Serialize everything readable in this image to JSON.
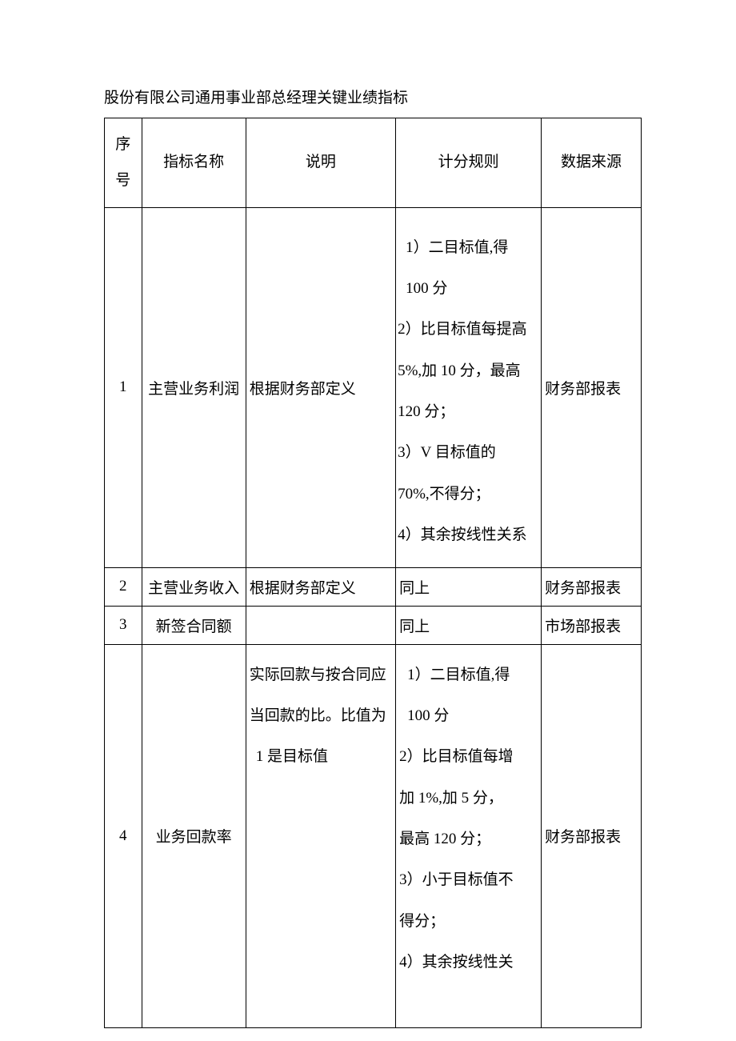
{
  "title": "股份有限公司通用事业部总经理关键业绩指标",
  "headers": {
    "seq": "序号",
    "name": "指标名称",
    "desc": "说明",
    "rule": "计分规则",
    "source": "数据来源"
  },
  "rows": [
    {
      "seq": "1",
      "name": "主营业务利润",
      "desc": "根据财务部定义",
      "rule_l1": "1）二目标值,得",
      "rule_l2": "100 分",
      "rule_l3": "2）比目标值每提高",
      "rule_l4": "5%,加 10 分，最高",
      "rule_l5": "120 分；",
      "rule_l6": "3）V 目标值的",
      "rule_l7": "70%,不得分；",
      "rule_l8": "4）其余按线性关系",
      "source": "财务部报表"
    },
    {
      "seq": "2",
      "name": "主营业务收入",
      "desc": "根据财务部定义",
      "rule": "同上",
      "source": "财务部报表"
    },
    {
      "seq": "3",
      "name": "新签合同额",
      "desc": "",
      "rule": "同上",
      "source": "市场部报表"
    },
    {
      "seq": "4",
      "name": "业务回款率",
      "desc_l1": "实际回款与按合同应",
      "desc_l2": "当回款的比。比值为",
      "desc_l3": "1 是目标值",
      "rule_l1": "1）二目标值,得",
      "rule_l2": "100 分",
      "rule_l3": "2）比目标值每增",
      "rule_l4": "加 1%,加 5 分，",
      "rule_l5": "最高 120 分；",
      "rule_l6": "3）小于目标值不",
      "rule_l7": "得分；",
      "rule_l8": "4）其余按线性关",
      "source": "财务部报表"
    }
  ]
}
